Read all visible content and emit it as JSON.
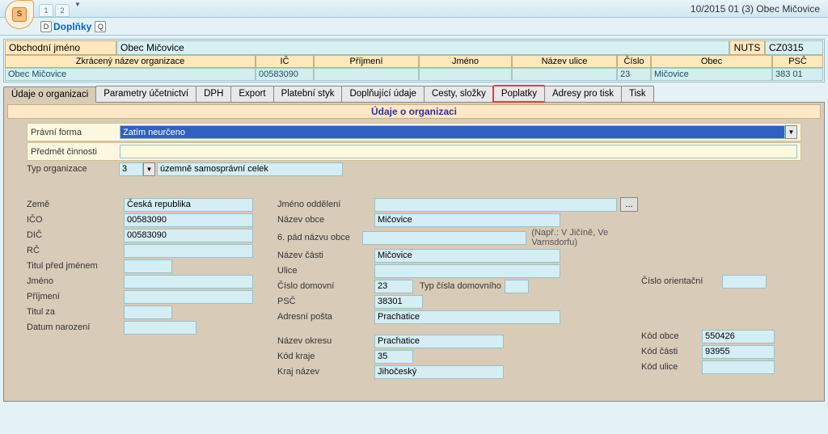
{
  "title_right": "10/2015  01  (3)  Obec Mičovice",
  "app_icon_letter": "S",
  "tab_minis": [
    "1",
    "2"
  ],
  "ribbon": {
    "link": "Doplňky",
    "hint1": "D",
    "hint2": "Q"
  },
  "header": {
    "obchodni_jmeno_label": "Obchodní jméno",
    "obchodni_jmeno_value": "Obec Mičovice",
    "nuts_label": "NUTS",
    "nuts_value": "CZ0315"
  },
  "grid": {
    "cols": [
      "Zkrácený název organizace",
      "IČ",
      "Příjmení",
      "Jméno",
      "Název ulice",
      "Číslo",
      "Obec",
      "PSČ"
    ],
    "row": [
      "Obec Mičovice",
      "00583090",
      "",
      "",
      "",
      "23",
      "Mičovice",
      "383 01"
    ]
  },
  "tabs": [
    "Údaje o  organizaci",
    "Parametry účetnictví",
    "DPH",
    "Export",
    "Platební styk",
    "Doplňující údaje",
    "Cesty, složky",
    "Poplatky",
    "Adresy pro tisk",
    "Tisk"
  ],
  "panel_title": "Údaje o organizaci",
  "legal": {
    "pravni_forma_label": "Právní forma",
    "pravni_forma_value": "Zatím neurčeno",
    "predmet_label": "Předmět činnosti",
    "predmet_value": "",
    "typ_org_label": "Typ organizace",
    "typ_org_code": "3",
    "typ_org_desc": "územně samosprávní celek"
  },
  "left": {
    "zeme_l": "Země",
    "zeme_v": "Česká republika",
    "ico_l": "IČO",
    "ico_v": "00583090",
    "dic_l": "DIČ",
    "dic_v": "00583090",
    "rc_l": "RČ",
    "rc_v": "",
    "titul_pred_l": "Titul před jménem",
    "titul_pred_v": "",
    "jmeno_l": "Jméno",
    "jmeno_v": "",
    "prijmeni_l": "Příjmení",
    "prijmeni_v": "",
    "titul_za_l": "Titul za",
    "titul_za_v": "",
    "datum_nar_l": "Datum narození",
    "datum_nar_v": ""
  },
  "mid": {
    "jmeno_odd_l": "Jméno oddělení",
    "jmeno_odd_v": "",
    "nazev_obce_l": "Název obce",
    "nazev_obce_v": "Mičovice",
    "pad6_l": "6. pád názvu obce",
    "pad6_v": "",
    "pad6_hint": "(Např.: V Jičíně, Ve Varnsdorfu)",
    "nazev_casti_l": "Název části",
    "nazev_casti_v": "Mičovice",
    "ulice_l": "Ulice",
    "ulice_v": "",
    "cislo_dom_l": "Číslo domovní",
    "cislo_dom_v": "23",
    "typ_cisla_l": "Typ čísla domovního",
    "typ_cisla_v": "",
    "cislo_orient_l": "Číslo orientační",
    "cislo_orient_v": "",
    "psc_l": "PSČ",
    "psc_v": "38301",
    "adr_posta_l": "Adresní pošta",
    "adr_posta_v": "Prachatice",
    "nazev_okresu_l": "Název okresu",
    "nazev_okresu_v": "Prachatice",
    "kod_kraje_l": "Kód kraje",
    "kod_kraje_v": "35",
    "kraj_nazev_l": "Kraj název",
    "kraj_nazev_v": "Jihočeský"
  },
  "right": {
    "kod_obce_l": "Kód obce",
    "kod_obce_v": "550426",
    "kod_casti_l": "Kód části",
    "kod_casti_v": "93955",
    "kod_ulice_l": "Kód ulice",
    "kod_ulice_v": ""
  },
  "browse_label": "..."
}
